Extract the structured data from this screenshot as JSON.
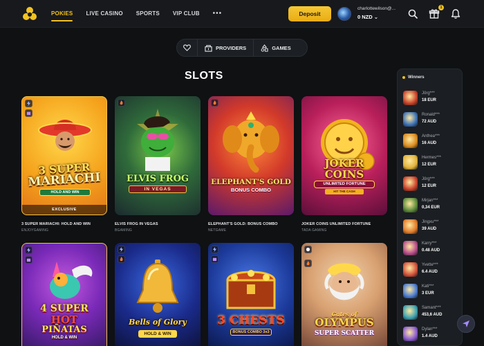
{
  "nav": {
    "items": [
      "POKIES",
      "LIVE CASINO",
      "SPORTS",
      "VIP CLUB"
    ],
    "more": "•••",
    "active": "POKIES"
  },
  "header": {
    "deposit_label": "Deposit",
    "user_name": "charlottewilson@...",
    "balance": "0 NZD",
    "notifications_count": "1",
    "accent": "#f3c221"
  },
  "filters": {
    "providers_label": "PROVIDERS",
    "games_label": "GAMES"
  },
  "section_title": "SLOTS",
  "games": [
    {
      "art_line1": "3 SUPER",
      "art_line2": "MARIACHI",
      "art_line3": "HOLD AND WIN",
      "badge": "EXCLUSIVE",
      "name": "3 SUPER MARIACHI: HOLD AND WIN",
      "provider": "ENJOYGAMING"
    },
    {
      "art_line1": "ELVIS FROG",
      "art_line2": "IN VEGAS",
      "art_line3": "",
      "badge": "",
      "name": "ELVIS FROG IN VEGAS",
      "provider": "BGAMING"
    },
    {
      "art_line1": "ELEPHANT'S GOLD",
      "art_line2": "BONUS COMBO",
      "art_line3": "",
      "badge": "",
      "name": "ELEPHANT'S GOLD: BONUS COMBO",
      "provider": "NETGAME"
    },
    {
      "art_line1": "JOKER",
      "art_line2": "COINS",
      "art_line3": "UNLIMITED FORTUNE",
      "art_line4": "HIT THE CASH",
      "badge": "",
      "name": "JOKER COINS UNLIMITED FORTUNE",
      "provider": "TADA GAMING"
    },
    {
      "art_line1": "4 SUPER",
      "art_line2": "HOT",
      "art_line3": "PIÑATAS",
      "art_line4": "HOLD & WIN",
      "badge": "",
      "name": "",
      "provider": ""
    },
    {
      "art_line1": "Bells of Glory",
      "art_line2": "HOLD & WIN",
      "art_line3": "",
      "badge": "",
      "name": "",
      "provider": ""
    },
    {
      "art_line1": "3 CHESTS",
      "art_line2": "BONUS COMBO 3x3",
      "art_line3": "",
      "badge": "",
      "name": "",
      "provider": ""
    },
    {
      "art_line1": "Gates of",
      "art_line2": "OLYMPUS",
      "art_line3": "SUPER SCATTER",
      "badge": "",
      "name": "",
      "provider": ""
    }
  ],
  "winners": {
    "title": "Winners",
    "list": [
      {
        "name": "Jörg***",
        "amount": "18 EUR",
        "color": "#c8402a"
      },
      {
        "name": "Ronald***",
        "amount": "72 AUD",
        "color": "#3a6fb5"
      },
      {
        "name": "Anthea***",
        "amount": "16 AUD",
        "color": "#d98a1f"
      },
      {
        "name": "Hermes***",
        "amount": "12 EUR",
        "color": "#e0b23a"
      },
      {
        "name": "Jörg***",
        "amount": "12 EUR",
        "color": "#c8402a"
      },
      {
        "name": "Mirjan***",
        "amount": "0,34 EUR",
        "color": "#5b8a3a"
      },
      {
        "name": "Jingxu***",
        "amount": "39 AUD",
        "color": "#e07a2a"
      },
      {
        "name": "Karry***",
        "amount": "0.48 AUD",
        "color": "#b44a8a"
      },
      {
        "name": "Yvette***",
        "amount": "6.4 AUD",
        "color": "#d1503a"
      },
      {
        "name": "Kati***",
        "amount": "3 EUR",
        "color": "#4a7ad1"
      },
      {
        "name": "Samant***",
        "amount": "453,6 AUD",
        "color": "#3aa0b0"
      },
      {
        "name": "Dylan***",
        "amount": "1.4 AUD",
        "color": "#8a5ad1"
      }
    ]
  }
}
